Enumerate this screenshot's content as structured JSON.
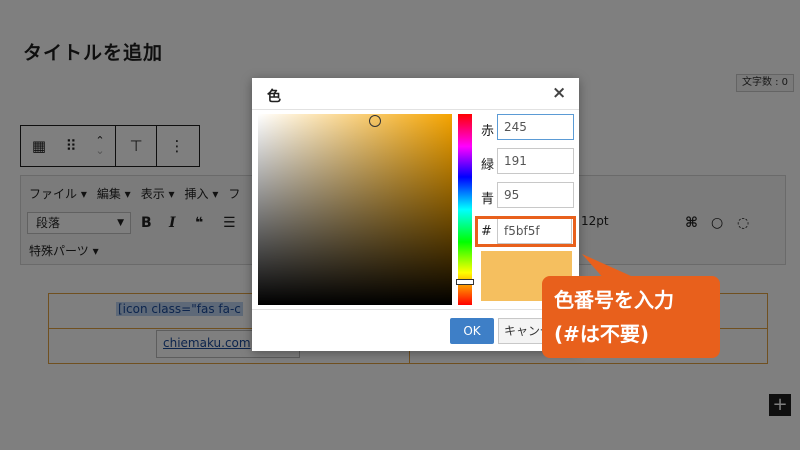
{
  "editor": {
    "title": "タイトルを追加",
    "char_count": "文字数 : 0",
    "menu": [
      "ファイル ▾",
      "編集 ▾",
      "表示 ▾",
      "挿入 ▾",
      "フ"
    ],
    "format_select": "段落",
    "font_size": "12pt",
    "special_parts": "特殊パーツ ▾",
    "cell_code": "[icon class=\"fas fa-c",
    "link_text": "chiemaku.com",
    "plus": "+"
  },
  "dialog": {
    "title": "色",
    "close": "×",
    "red_label": "赤",
    "red_value": "245",
    "green_label": "緑",
    "green_value": "191",
    "blue_label": "青",
    "blue_value": "95",
    "hex_label": "#",
    "hex_value": "f5bf5f",
    "ok": "OK",
    "cancel": "キャンセル",
    "preview_color": "#f5bf5f"
  },
  "callout": {
    "line1": "色番号を入力",
    "line2": "(#は不要)",
    "color": "#e8601c"
  }
}
